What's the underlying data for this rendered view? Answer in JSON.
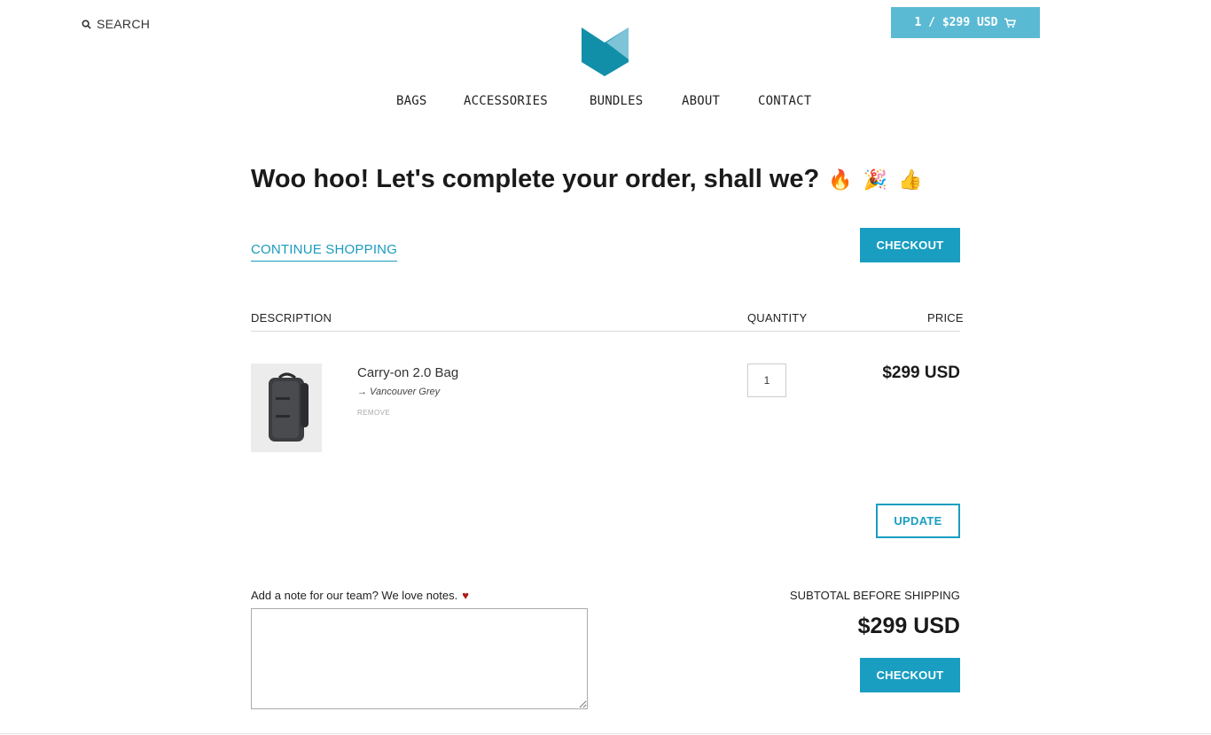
{
  "header": {
    "search_label": "SEARCH",
    "cart_label": "1 / $299 USD",
    "nav": [
      "BAGS",
      "ACCESSORIES",
      "BUNDLES",
      "ABOUT",
      "CONTACT"
    ]
  },
  "cart": {
    "headline": "Woo hoo! Let's complete your order, shall we?",
    "headline_emojis": [
      "🔥",
      "🎉",
      "👍"
    ],
    "continue_label": "CONTINUE SHOPPING",
    "checkout_label": "CHECKOUT",
    "columns": {
      "description": "DESCRIPTION",
      "quantity": "QUANTITY",
      "price": "PRICE"
    },
    "items": [
      {
        "title": "Carry-on 2.0 Bag",
        "variant": "→ Vancouver Grey",
        "remove_label": "REMOVE",
        "quantity": "1",
        "price": "$299 USD"
      }
    ],
    "update_label": "UPDATE",
    "note_label": "Add a note for our team? We love notes.",
    "note_value": "",
    "subtotal_label": "SUBTOTAL BEFORE SHIPPING",
    "subtotal_value": "$299 USD"
  },
  "colors": {
    "accent": "#199ec1",
    "cart_button": "#5bbad3",
    "heart": "#b01818"
  }
}
